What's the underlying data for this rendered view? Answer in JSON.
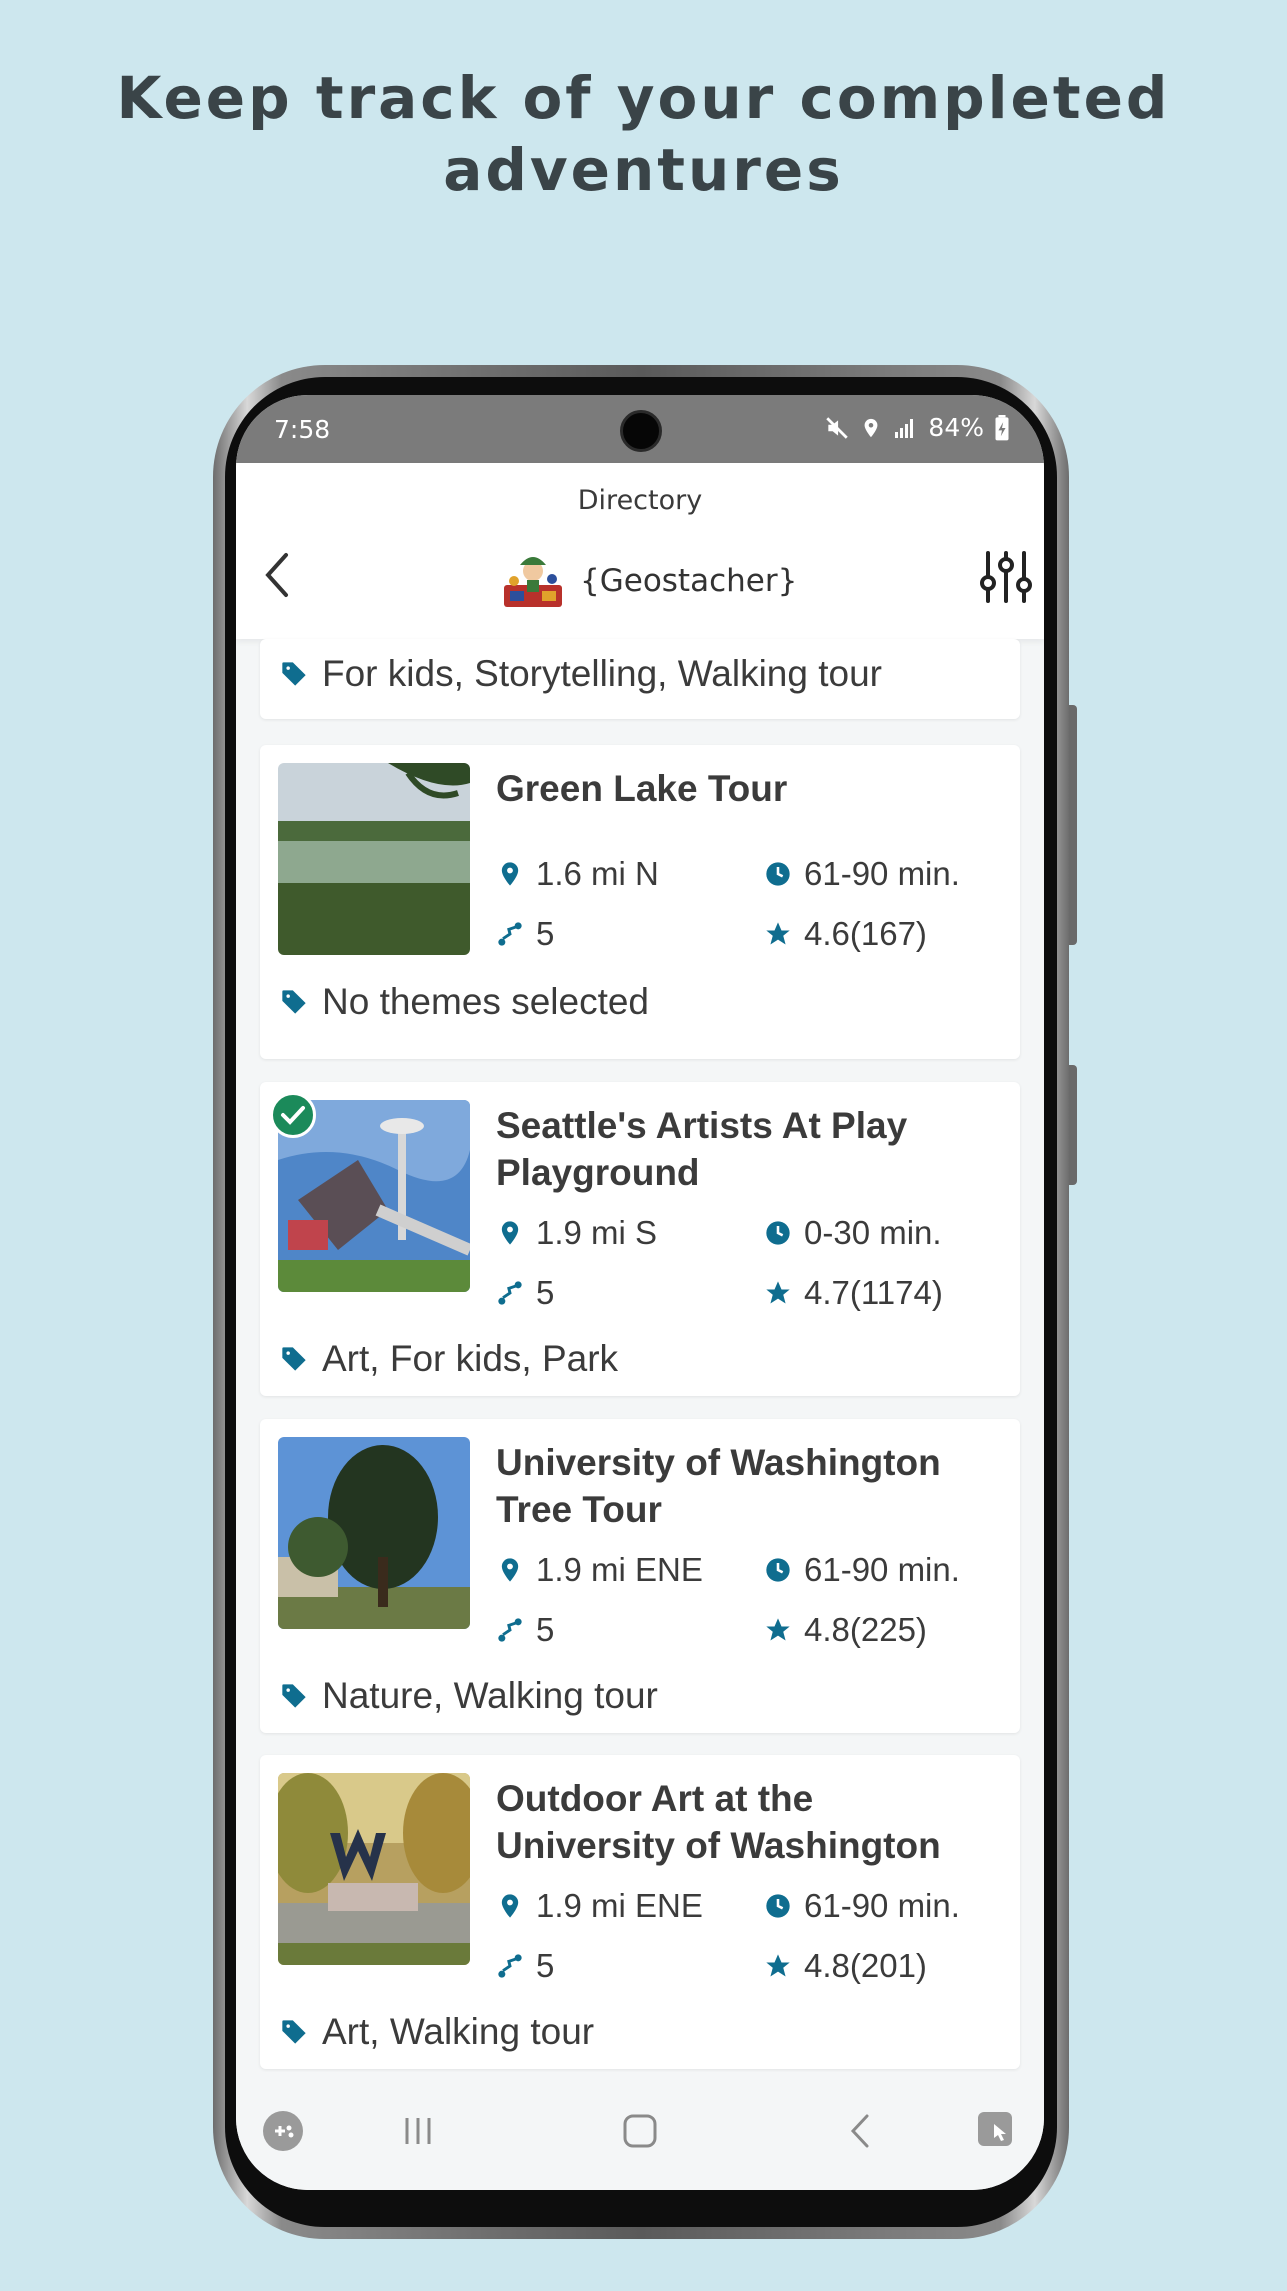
{
  "headline": {
    "line1": "Keep track of your completed",
    "line2": "adventures"
  },
  "status_bar": {
    "time": "7:58",
    "battery": "84%",
    "icons": [
      "mute-icon",
      "location-icon",
      "signal-icon",
      "battery-icon"
    ]
  },
  "header": {
    "screen_title": "Directory",
    "app_name": "{Geostacher}",
    "icons": [
      "back-chevron-icon",
      "app-logo",
      "filter-sliders-icon"
    ]
  },
  "colors": {
    "background": "#cde7ee",
    "accent": "#0f6d8f",
    "check_badge": "#1b8a5a",
    "text": "#3b3b3b"
  },
  "partial_card": {
    "tags": "For kids, Storytelling, Walking tour"
  },
  "tours": [
    {
      "title": "Green Lake Tour",
      "distance": "1.6 mi N",
      "duration": "61-90 min.",
      "stops": "5",
      "rating": "4.6(167)",
      "themes": "No themes selected",
      "completed": false
    },
    {
      "title": "Seattle's Artists At Play Playground",
      "distance": "1.9 mi S",
      "duration": "0-30 min.",
      "stops": "5",
      "rating": "4.7(1174)",
      "themes": "Art, For kids, Park",
      "completed": true
    },
    {
      "title": "University of Washington Tree Tour",
      "distance": "1.9 mi ENE",
      "duration": "61-90 min.",
      "stops": "5",
      "rating": "4.8(225)",
      "themes": "Nature, Walking tour",
      "completed": false
    },
    {
      "title": "Outdoor Art at the University of Washington",
      "distance": "1.9 mi ENE",
      "duration": "61-90 min.",
      "stops": "5",
      "rating": "4.8(201)",
      "themes": "Art, Walking tour",
      "completed": false
    }
  ],
  "nav_bar": {
    "icons": [
      "game-launcher-icon",
      "recent-apps-icon",
      "home-icon",
      "back-icon",
      "assistant-icon"
    ]
  }
}
